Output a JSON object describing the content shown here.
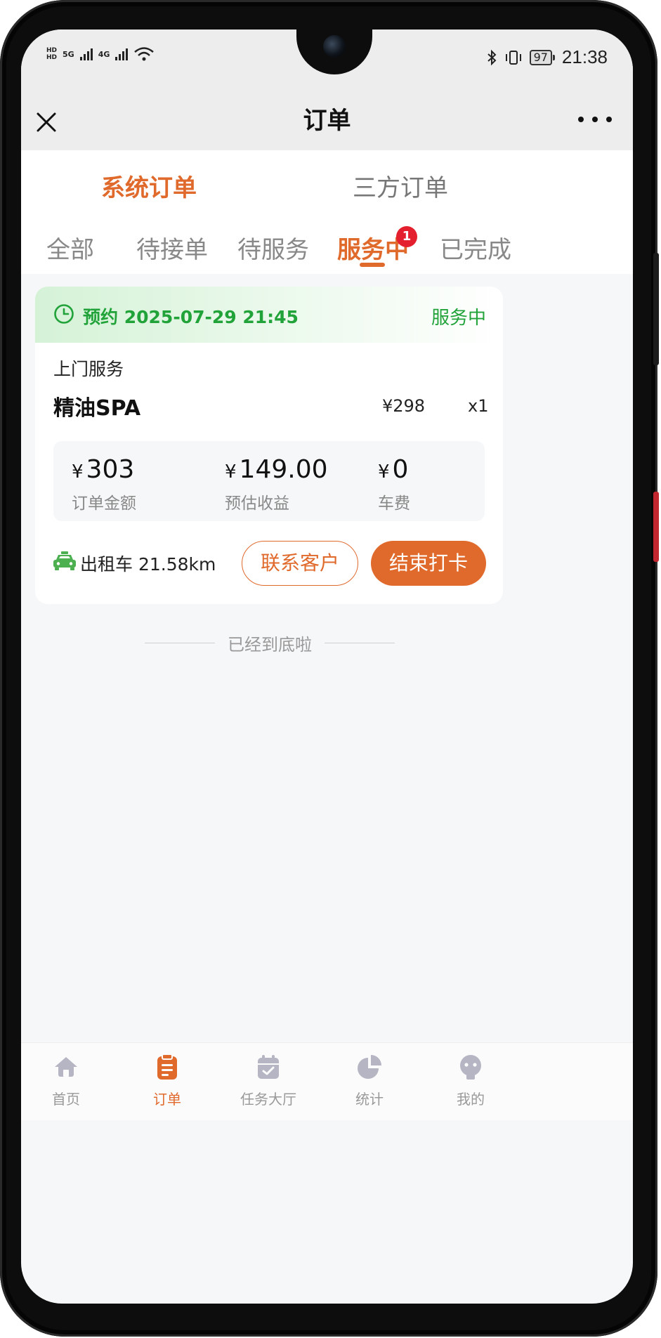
{
  "status_bar": {
    "network_left": [
      "5G",
      "4G"
    ],
    "battery": "97",
    "time": "21:38"
  },
  "header": {
    "title": "订单"
  },
  "main_tabs": [
    {
      "label": "系统订单",
      "active": true
    },
    {
      "label": "三方订单",
      "active": false
    }
  ],
  "sub_tabs": [
    {
      "label": "全部"
    },
    {
      "label": "待接单"
    },
    {
      "label": "待服务"
    },
    {
      "label": "服务中",
      "badge": "1",
      "active": true
    },
    {
      "label": "已完成"
    }
  ],
  "order": {
    "appointment_prefix": "预约",
    "appointment_time": "2025-07-29 21:45",
    "status": "服务中",
    "service_type": "上门服务",
    "service_name": "精油SPA",
    "service_price": "¥298",
    "service_qty": "x1",
    "stats": [
      {
        "currency": "¥",
        "value": "303",
        "label": "订单金额"
      },
      {
        "currency": "¥",
        "value": "149.00",
        "label": "预估收益"
      },
      {
        "currency": "¥",
        "value": "0",
        "label": "车费"
      }
    ],
    "transport": "出租车",
    "distance": "21.58km",
    "contact_button": "联系客户",
    "end_button": "结束打卡"
  },
  "list_end_text": "已经到底啦",
  "bottom_nav": [
    {
      "label": "首页",
      "icon": "home-icon",
      "active": false
    },
    {
      "label": "订单",
      "icon": "clipboard-icon",
      "active": true
    },
    {
      "label": "任务大厅",
      "icon": "calendar-check-icon",
      "active": false
    },
    {
      "label": "统计",
      "icon": "pie-chart-icon",
      "active": false
    },
    {
      "label": "我的",
      "icon": "profile-icon",
      "active": false
    }
  ],
  "colors": {
    "accent": "#e06a2c",
    "success": "#21a33a",
    "badge": "#e5202e"
  }
}
